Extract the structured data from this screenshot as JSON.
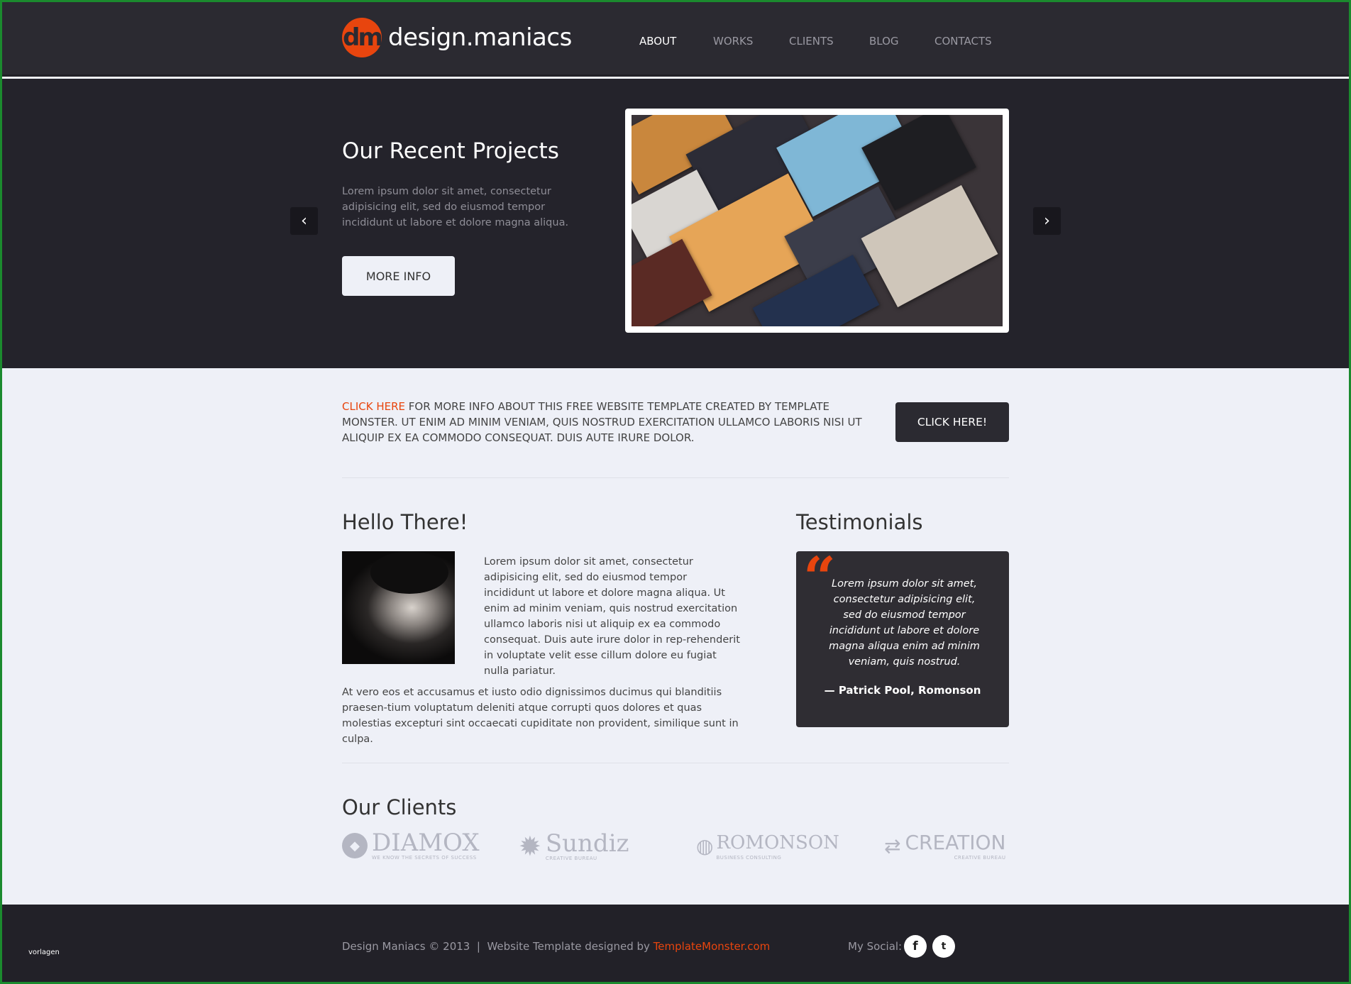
{
  "header": {
    "logo_mark": "dm",
    "logo_text": "design.maniacs",
    "nav": [
      {
        "label": "ABOUT",
        "active": true
      },
      {
        "label": "WORKS"
      },
      {
        "label": "CLIENTS"
      },
      {
        "label": "BLOG"
      },
      {
        "label": "CONTACTS"
      }
    ]
  },
  "hero": {
    "title": "Our Recent Projects",
    "text": "Lorem ipsum dolor sit amet, consectetur adipisicing elit, sed do eiusmod tempor incididunt ut labore et dolore magna aliqua.",
    "button": "MORE INFO",
    "prev_icon": "chevron-left",
    "next_icon": "chevron-right"
  },
  "cta": {
    "link": "CLICK HERE",
    "text": " FOR MORE INFO ABOUT THIS FREE WEBSITE TEMPLATE CREATED BY TEMPLATE MONSTER. UT ENIM AD MINIM VENIAM, QUIS NOSTRUD EXERCITATION ULLAMCO LABORIS NISI UT ALIQUIP EX EA COMMODO CONSEQUAT. DUIS AUTE IRURE DOLOR.",
    "button": "CLICK HERE!"
  },
  "hello": {
    "title": "Hello There!",
    "text1": "Lorem ipsum dolor sit amet, consectetur adipisicing elit, sed do eiusmod tempor incididunt ut labore et dolore magna aliqua. Ut enim ad minim veniam, quis nostrud exercitation ullamco laboris nisi ut aliquip ex ea commodo consequat. Duis aute irure dolor in rep-rehenderit in voluptate velit esse cillum dolore eu fugiat nulla pariatur.",
    "text2": "At vero eos et accusamus et iusto odio dignissimos ducimus qui blanditiis praesen-tium voluptatum deleniti atque corrupti quos dolores et quas molestias excepturi sint occaecati cupiditate non provident, similique sunt in culpa."
  },
  "testimonials": {
    "title": "Testimonials",
    "quote": "Lorem ipsum dolor sit amet, consectetur adipisicing elit, sed do eiusmod tempor incididunt ut labore et dolore magna aliqua enim ad minim veniam, quis nostrud.",
    "author": "— Patrick Pool, Romonson"
  },
  "clients": {
    "title": "Our Clients",
    "logos": [
      {
        "name": "DIAMOX",
        "tagline": "WE KNOW THE SECRETS OF SUCCESS"
      },
      {
        "name": "Sundiz",
        "tagline": "CREATIVE BUREAU"
      },
      {
        "name": "ROMONSON",
        "tagline": "BUSINESS CONSULTING"
      },
      {
        "name": "CREATION",
        "tagline": "CREATIVE BUREAU"
      }
    ]
  },
  "footer": {
    "copyright": "Design Maniacs © 2013  |  Website Template designed by ",
    "link": "TemplateMonster.com",
    "social_label": "My Social:",
    "social": [
      "facebook",
      "twitter"
    ],
    "watermark": "vorlagen"
  },
  "colors": {
    "accent": "#e8450e",
    "dark": "#2b2a31",
    "light": "#eef0f7",
    "border": "#1b8a2e"
  }
}
